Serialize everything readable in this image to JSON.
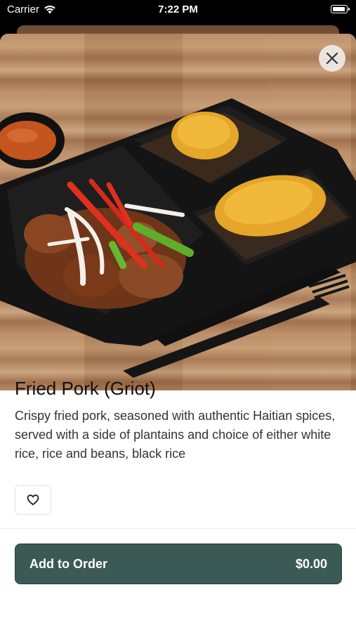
{
  "status_bar": {
    "carrier": "Carrier",
    "time": "7:22 PM"
  },
  "item": {
    "name": "Fried Pork (Griot)",
    "description": "Crispy fried pork, seasoned with authentic Haitian spices, served with a side of plantains and choice of either white rice, rice and beans, black rice"
  },
  "actions": {
    "add_to_order_label": "Add to Order",
    "price": "$0.00"
  },
  "icons": {
    "close": "close-icon",
    "favorite": "heart-icon",
    "wifi": "wifi-icon",
    "battery": "battery-icon"
  },
  "colors": {
    "primary_button": "#3b5a55",
    "background": "#ffffff"
  }
}
